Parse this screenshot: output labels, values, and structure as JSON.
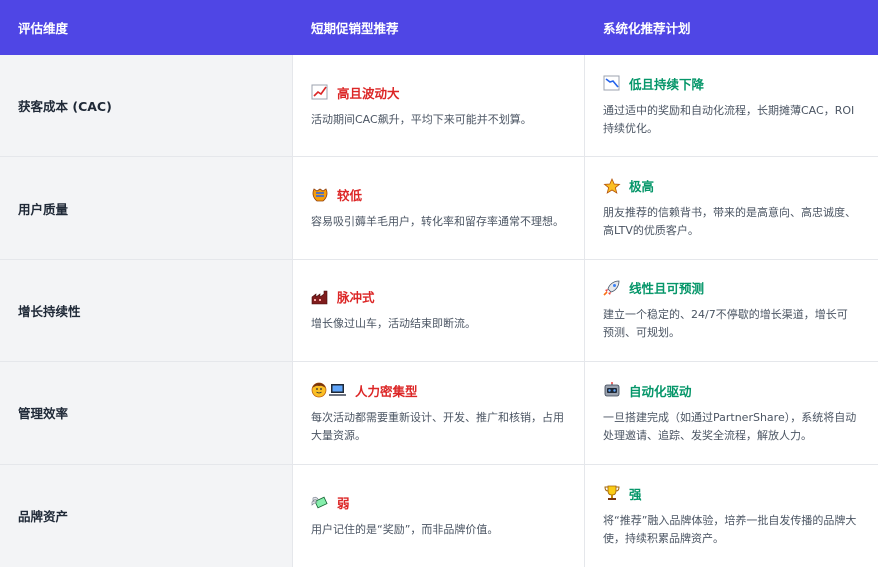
{
  "header": {
    "col1": "评估维度",
    "col2": "短期促销型推荐",
    "col3": "系统化推荐计划"
  },
  "rows": [
    {
      "dimension": "获客成本 (CAC)",
      "short": {
        "icon": "chart-up-icon",
        "title": "高且波动大",
        "desc": "活动期间CAC飙升，平均下来可能并不划算。"
      },
      "system": {
        "icon": "chart-down-icon",
        "title": "低且持续下降",
        "desc": "通过适中的奖励和自动化流程，长期摊薄CAC，ROI持续优化。"
      }
    },
    {
      "dimension": "用户质量",
      "short": {
        "icon": "wool-icon",
        "title": "较低",
        "desc": "容易吸引薅羊毛用户，转化率和留存率通常不理想。"
      },
      "system": {
        "icon": "star-icon",
        "title": "极高",
        "desc": "朋友推荐的信赖背书，带来的是高意向、高忠诚度、高LTV的优质客户。"
      }
    },
    {
      "dimension": "增长持续性",
      "short": {
        "icon": "factory-icon",
        "title": "脉冲式",
        "desc": "增长像过山车，活动结束即断流。"
      },
      "system": {
        "icon": "rocket-icon",
        "title": "线性且可预测",
        "desc": "建立一个稳定的、24/7不停歇的增长渠道，增长可预测、可规划。"
      }
    },
    {
      "dimension": "管理效率",
      "short": {
        "icon": "person-computer-icon",
        "title": "人力密集型",
        "desc": "每次活动都需要重新设计、开发、推广和核销，占用大量资源。"
      },
      "system": {
        "icon": "robot-icon",
        "title": "自动化驱动",
        "desc": "一旦搭建完成（如通过PartnerShare），系统将自动处理邀请、追踪、发奖全流程，解放人力。"
      }
    },
    {
      "dimension": "品牌资产",
      "short": {
        "icon": "money-wings-icon",
        "title": "弱",
        "desc": "用户记住的是“奖励”，而非品牌价值。"
      },
      "system": {
        "icon": "trophy-icon",
        "title": "强",
        "desc": "将“推荐”融入品牌体验，培养一批自发传播的品牌大使，持续积累品牌资产。"
      }
    }
  ],
  "colors": {
    "header_bg": "#4f46e5",
    "negative": "#dc2626",
    "positive": "#059669",
    "dim_bg": "#f3f4f6"
  }
}
